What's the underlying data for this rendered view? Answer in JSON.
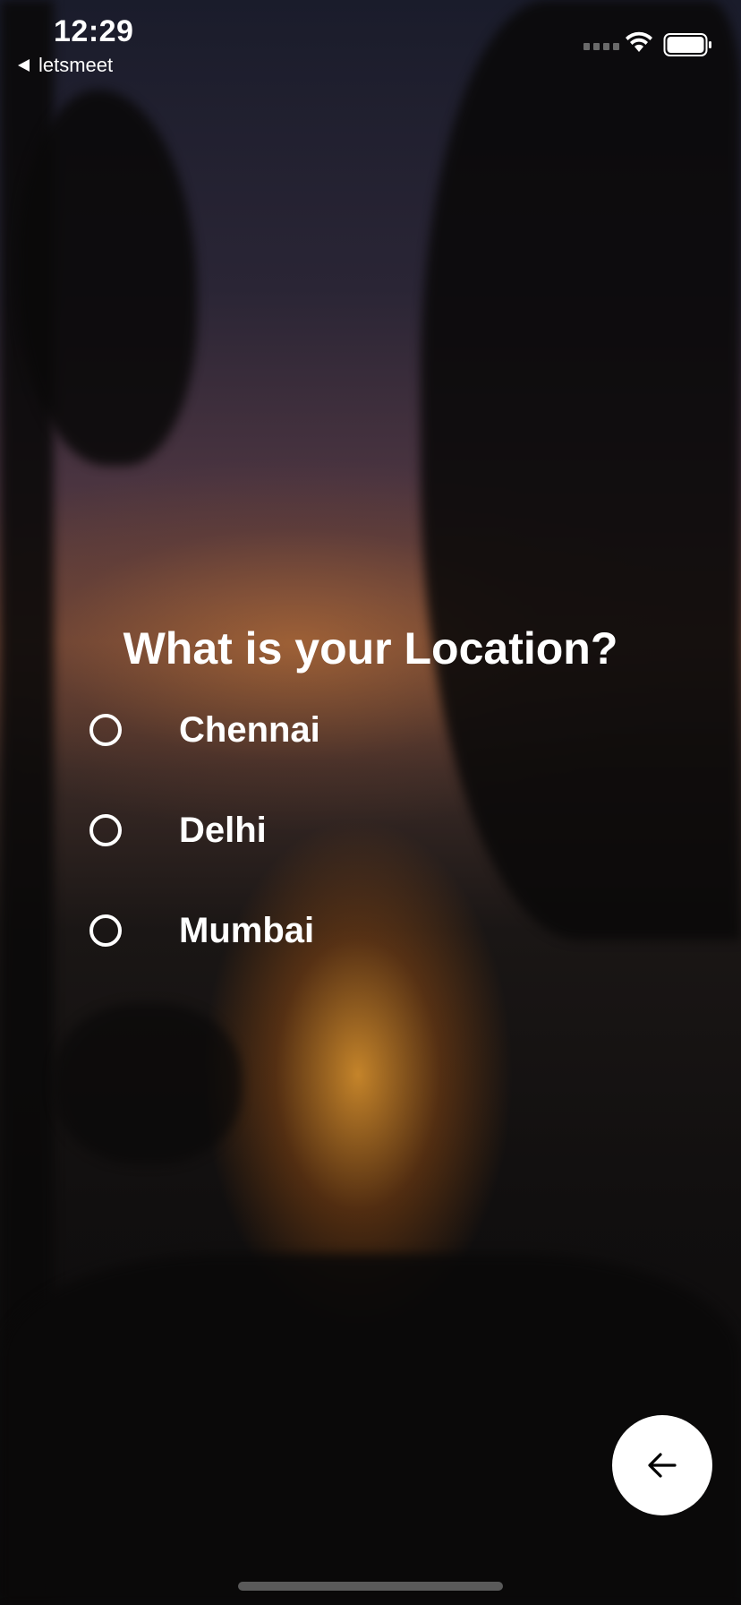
{
  "status_bar": {
    "time": "12:29",
    "back_app": "letsmeet"
  },
  "question": {
    "title": "What is your Location?",
    "options": [
      {
        "label": "Chennai",
        "selected": false
      },
      {
        "label": "Delhi",
        "selected": false
      },
      {
        "label": "Mumbai",
        "selected": false
      }
    ]
  },
  "fab": {
    "icon": "arrow-left-icon"
  },
  "colors": {
    "text": "#ffffff",
    "fab_background": "#ffffff",
    "fab_icon": "#000000"
  }
}
